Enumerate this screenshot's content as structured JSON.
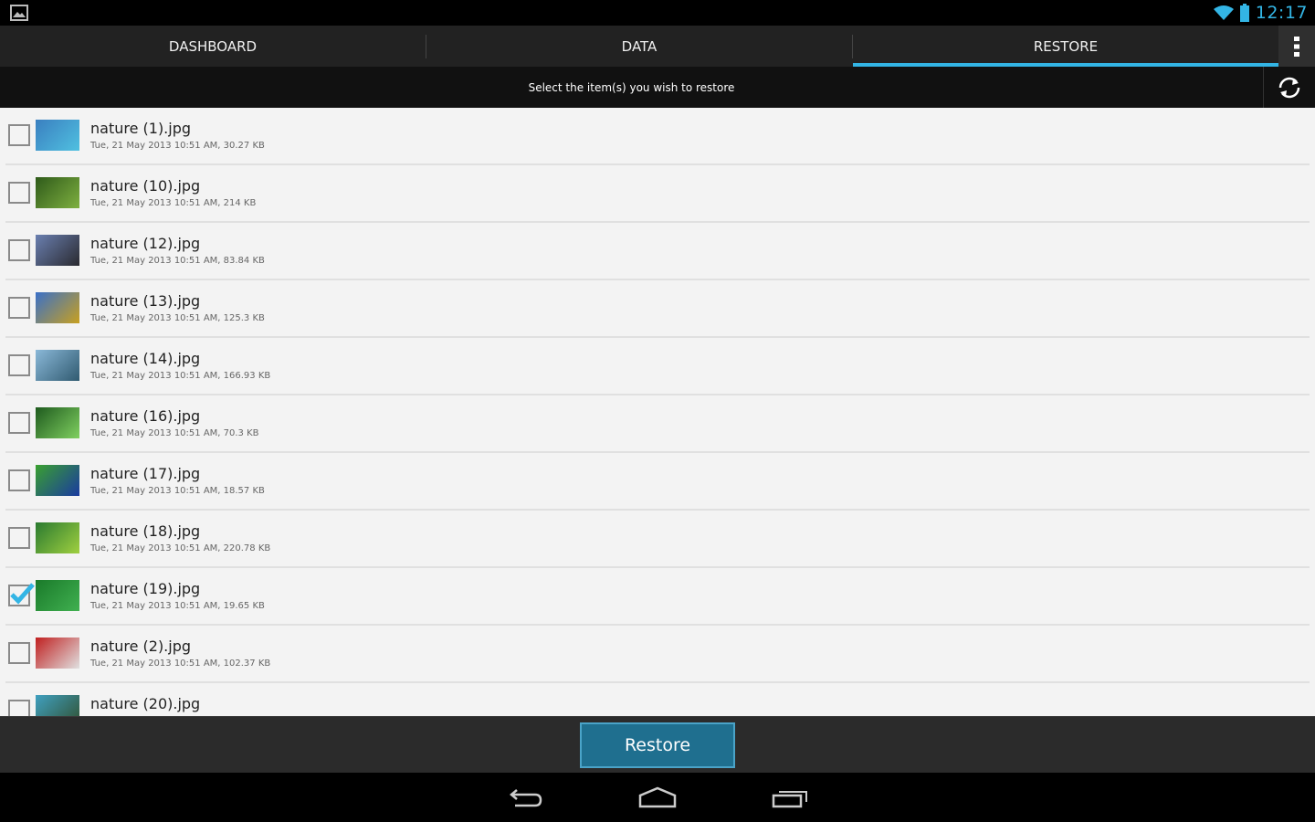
{
  "status_bar": {
    "time": "12:17",
    "left_icon": "image-notification-icon",
    "wifi_icon": "wifi-icon",
    "battery_icon": "battery-icon",
    "accent_color": "#33b5e5"
  },
  "tabs": [
    {
      "label": "DASHBOARD",
      "selected": false
    },
    {
      "label": "DATA",
      "selected": false
    },
    {
      "label": "RESTORE",
      "selected": true
    }
  ],
  "subheader": {
    "text": "Select the item(s) you wish to restore",
    "refresh_icon": "refresh-icon"
  },
  "files": [
    {
      "name": "nature (1).jpg",
      "meta": "Tue, 21 May 2013 10:51 AM, 30.27 KB",
      "checked": false,
      "thumb_colors": [
        "#3a7fc0",
        "#50c0e0"
      ]
    },
    {
      "name": "nature (10).jpg",
      "meta": "Tue, 21 May 2013 10:51 AM, 214 KB",
      "checked": false,
      "thumb_colors": [
        "#2e5a1a",
        "#7fb040"
      ]
    },
    {
      "name": "nature (12).jpg",
      "meta": "Tue, 21 May 2013 10:51 AM, 83.84 KB",
      "checked": false,
      "thumb_colors": [
        "#6a7fb0",
        "#2a2a30"
      ]
    },
    {
      "name": "nature (13).jpg",
      "meta": "Tue, 21 May 2013 10:51 AM, 125.3 KB",
      "checked": false,
      "thumb_colors": [
        "#3a70c8",
        "#c8a020"
      ]
    },
    {
      "name": "nature (14).jpg",
      "meta": "Tue, 21 May 2013 10:51 AM, 166.93 KB",
      "checked": false,
      "thumb_colors": [
        "#8ab8d8",
        "#305a70"
      ]
    },
    {
      "name": "nature (16).jpg",
      "meta": "Tue, 21 May 2013 10:51 AM, 70.3 KB",
      "checked": false,
      "thumb_colors": [
        "#1e5a1e",
        "#80d060"
      ]
    },
    {
      "name": "nature (17).jpg",
      "meta": "Tue, 21 May 2013 10:51 AM, 18.57 KB",
      "checked": false,
      "thumb_colors": [
        "#3aa030",
        "#1a3aa0"
      ]
    },
    {
      "name": "nature (18).jpg",
      "meta": "Tue, 21 May 2013 10:51 AM, 220.78 KB",
      "checked": false,
      "thumb_colors": [
        "#2a7a30",
        "#a0d040"
      ]
    },
    {
      "name": "nature (19).jpg",
      "meta": "Tue, 21 May 2013 10:51 AM, 19.65 KB",
      "checked": true,
      "thumb_colors": [
        "#1a7a2a",
        "#40b050"
      ]
    },
    {
      "name": "nature (2).jpg",
      "meta": "Tue, 21 May 2013 10:51 AM, 102.37 KB",
      "checked": false,
      "thumb_colors": [
        "#c02020",
        "#e0e0e0"
      ]
    },
    {
      "name": "nature (20).jpg",
      "meta": "",
      "checked": false,
      "thumb_colors": [
        "#40a0c0",
        "#305030"
      ]
    }
  ],
  "action": {
    "restore_label": "Restore"
  },
  "nav": {
    "back_icon": "back-icon",
    "home_icon": "home-icon",
    "recents_icon": "recent-apps-icon"
  }
}
